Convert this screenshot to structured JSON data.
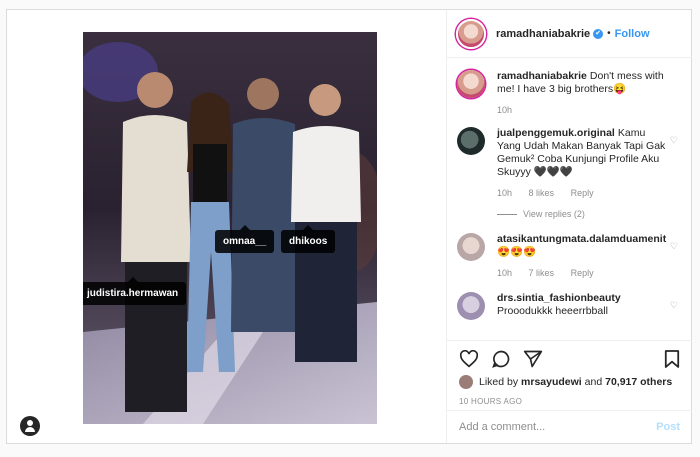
{
  "header": {
    "username": "ramadhaniabakrie",
    "verified_mark": "✔",
    "separator": "•",
    "follow_label": "Follow"
  },
  "photo": {
    "tags": [
      "judistira.hermawan",
      "omnaa__",
      "dhikoos"
    ]
  },
  "caption": {
    "username": "ramadhaniabakrie",
    "text": "Don't mess with me! I have 3 big brothers😝",
    "time": "10h"
  },
  "comments": [
    {
      "username": "jualpenggemuk.original",
      "text": "Kamu Yang Udah Makan Banyak Tapi Gak Gemuk² Coba Kunjungi Profile Aku Skuyyy 🖤🖤🖤",
      "time": "10h",
      "likes": "8 likes",
      "reply": "Reply",
      "view_replies": "View replies (2)"
    },
    {
      "username": "atasikantungmata.dalamduamenit",
      "text": "😍😍😍",
      "time": "10h",
      "likes": "7 likes",
      "reply": "Reply"
    },
    {
      "username": "drs.sintia_fashionbeauty",
      "text": "Prooodukkk heeerrbball"
    }
  ],
  "actions": {
    "icons": [
      "heart-icon",
      "comment-icon",
      "share-icon",
      "bookmark-icon"
    ]
  },
  "likes": {
    "prefix": "Liked by",
    "user": "mrsayudewi",
    "middle": "and",
    "count": "70,917 others"
  },
  "posted_ago": "10 HOURS AGO",
  "add_comment": {
    "placeholder": "Add a comment...",
    "post_label": "Post"
  }
}
